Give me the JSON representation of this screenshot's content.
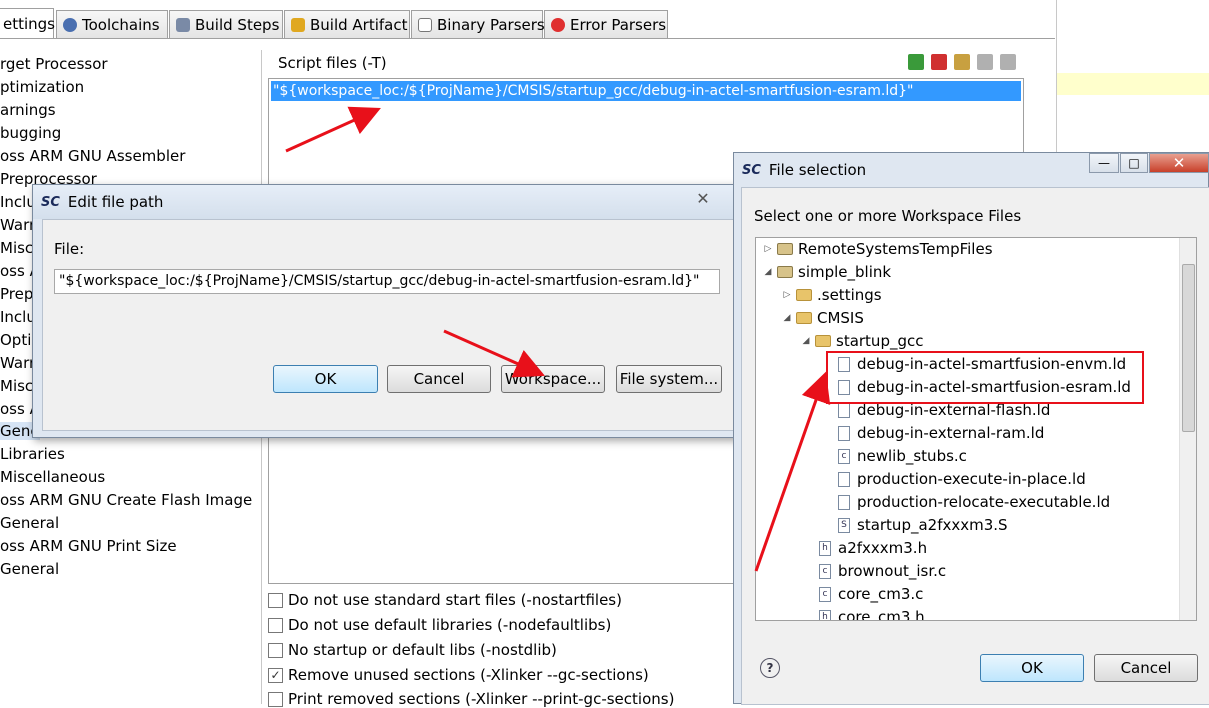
{
  "tabs": [
    {
      "label": "ettings",
      "icon": "settings-icon",
      "active": true
    },
    {
      "label": "Toolchains",
      "icon": "gear-icon"
    },
    {
      "label": "Build Steps",
      "icon": "wrench-icon"
    },
    {
      "label": "Build Artifact",
      "icon": "trophy-icon"
    },
    {
      "label": "Binary Parsers",
      "icon": "document-icon"
    },
    {
      "label": "Error Parsers",
      "icon": "error-icon"
    }
  ],
  "left_tree": [
    "rget Processor",
    "ptimization",
    "arnings",
    "bugging",
    "oss ARM GNU Assembler",
    "Preprocessor",
    "Inclu",
    "Warr",
    "Misc",
    "oss A",
    "Prep",
    "Inclu",
    "Opti",
    "Warr",
    "Misc",
    "oss A",
    "Gene",
    "Libraries",
    "Miscellaneous",
    "oss ARM GNU Create Flash Image",
    "General",
    "oss ARM GNU Print Size",
    "General"
  ],
  "script_files": {
    "label": "Script files (-T)",
    "entries": [
      "\"${workspace_loc:/${ProjName}/CMSIS/startup_gcc/debug-in-actel-smartfusion-esram.ld}\""
    ]
  },
  "options": [
    {
      "label": "Do not use standard start files (-nostartfiles)",
      "checked": false
    },
    {
      "label": "Do not use default libraries (-nodefaultlibs)",
      "checked": false
    },
    {
      "label": "No startup or default libs (-nostdlib)",
      "checked": false
    },
    {
      "label": "Remove unused sections (-Xlinker --gc-sections)",
      "checked": true
    },
    {
      "label": "Print removed sections (-Xlinker --print-gc-sections)",
      "checked": false
    }
  ],
  "edit_dialog": {
    "app_badge": "SC",
    "title": "Edit file path",
    "close_glyph": "✕",
    "file_label": "File:",
    "file_value": "\"${workspace_loc:/${ProjName}/CMSIS/startup_gcc/debug-in-actel-smartfusion-esram.ld}\"",
    "ok": "OK",
    "cancel": "Cancel",
    "workspace": "Workspace...",
    "filesystem": "File system..."
  },
  "file_dialog": {
    "app_badge": "SC",
    "title": "File selection",
    "prompt": "Select one or more Workspace Files",
    "minimize_glyph": "—",
    "maximize_glyph": "□",
    "close_glyph": "✕",
    "help_glyph": "?",
    "ok": "OK",
    "cancel": "Cancel",
    "tree": [
      {
        "label": "RemoteSystemsTempFiles",
        "kind": "project",
        "twisty": "▷"
      },
      {
        "label": "simple_blink",
        "kind": "project",
        "twisty": "◢"
      },
      {
        "label": ".settings",
        "kind": "folder",
        "twisty": "▷"
      },
      {
        "label": "CMSIS",
        "kind": "folder",
        "twisty": "◢"
      },
      {
        "label": "startup_gcc",
        "kind": "folder",
        "twisty": "◢"
      },
      {
        "label": "debug-in-actel-smartfusion-envm.ld",
        "kind": "file"
      },
      {
        "label": "debug-in-actel-smartfusion-esram.ld",
        "kind": "file"
      },
      {
        "label": "debug-in-external-flash.ld",
        "kind": "file"
      },
      {
        "label": "debug-in-external-ram.ld",
        "kind": "file"
      },
      {
        "label": "newlib_stubs.c",
        "kind": "cfile"
      },
      {
        "label": "production-execute-in-place.ld",
        "kind": "file"
      },
      {
        "label": "production-relocate-executable.ld",
        "kind": "file"
      },
      {
        "label": "startup_a2fxxxm3.S",
        "kind": "sfile"
      },
      {
        "label": "a2fxxxm3.h",
        "kind": "hfile"
      },
      {
        "label": "brownout_isr.c",
        "kind": "cfile"
      },
      {
        "label": "core_cm3.c",
        "kind": "cfile"
      },
      {
        "label": "core_cm3.h",
        "kind": "hfile"
      }
    ]
  },
  "colors": {
    "selection": "#3399ff",
    "annotation": "#e8101a"
  }
}
